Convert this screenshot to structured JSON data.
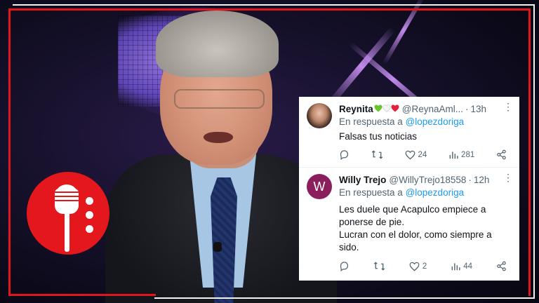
{
  "logo": {
    "name": "microphone-logo"
  },
  "tweets": [
    {
      "name": "Reynita",
      "emoji": "💚🤍❤️",
      "handle": "@ReynaAml...",
      "time": "13h",
      "reply_prefix": "En respuesta a",
      "reply_to": "@lopezdoriga",
      "text_lines": [
        "Falsas tus noticias"
      ],
      "likes": "24",
      "views": "281",
      "avatar": "photo"
    },
    {
      "name": "Willy Trejo",
      "emoji": "",
      "handle": "@WillyTrejo18558",
      "time": "12h",
      "reply_prefix": "En respuesta a",
      "reply_to": "@lopezdoriga",
      "text_lines": [
        "Les duele que Acapulco empiece a",
        "ponerse de pie.",
        "Lucran con el dolor, como siempre a",
        "sido."
      ],
      "likes": "2",
      "views": "44",
      "avatar_letter": "W"
    }
  ],
  "colors": {
    "frame_red": "#e0161c",
    "link": "#1d9bf0",
    "secondary_text": "#536471",
    "avatar2": "#8b1e5d"
  },
  "icons": [
    "reply-icon",
    "retweet-icon",
    "like-icon",
    "views-icon",
    "share-icon",
    "more-icon"
  ]
}
